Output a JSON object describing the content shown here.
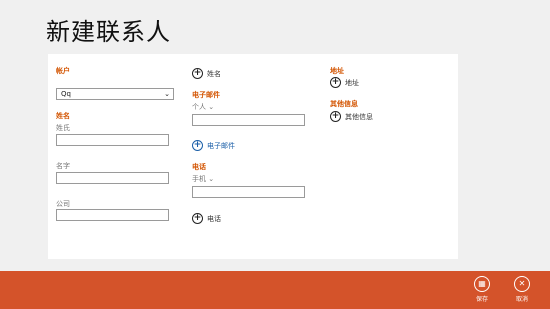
{
  "page_title": "新建联系人",
  "column1": {
    "account_label": "帐户",
    "account_value": "Qq",
    "name_label": "姓名",
    "surname_label": "姓氏",
    "given_name_label": "名字",
    "company_label": "公司"
  },
  "column2": {
    "add_name": "姓名",
    "email_label": "电子邮件",
    "email_type": "个人",
    "add_email": "电子邮件",
    "phone_label": "电话",
    "phone_type": "手机",
    "add_phone": "电话"
  },
  "column3": {
    "address_label": "地址",
    "add_address": "地址",
    "other_info_label": "其他信息",
    "add_other_info": "其他信息"
  },
  "app_bar": {
    "save_label": "保存",
    "cancel_label": "取消"
  },
  "colors": {
    "accent": "#d35400",
    "app_bar": "#d4532a",
    "link": "#1b5fa8"
  }
}
